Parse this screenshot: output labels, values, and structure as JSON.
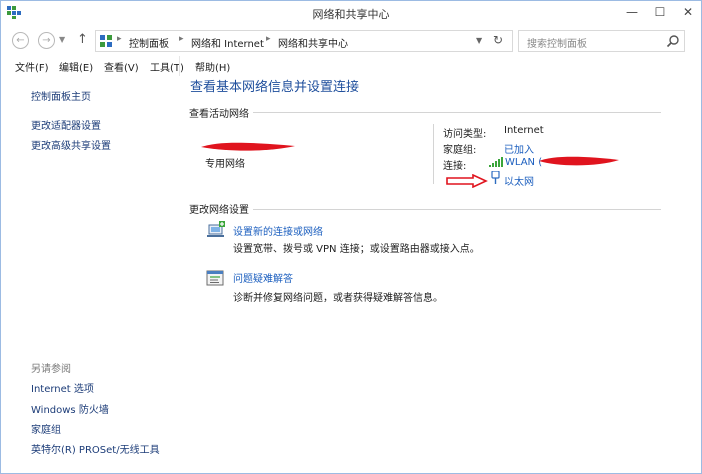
{
  "window": {
    "title": "网络和共享中心",
    "controls": {
      "minimize": "—",
      "maximize": "☐",
      "close": "✕"
    }
  },
  "address_bar": {
    "breadcrumbs": [
      "控制面板",
      "网络和 Internet",
      "网络和共享中心"
    ],
    "search_placeholder": "搜索控制面板"
  },
  "menu": [
    "文件(F)",
    "编辑(E)",
    "查看(V)",
    "工具(T)",
    "帮助(H)"
  ],
  "sidebar": {
    "links": [
      "控制面板主页",
      "更改适配器设置",
      "更改高级共享设置"
    ],
    "see_also_title": "另请参阅",
    "see_also": [
      "Internet 选项",
      "Windows 防火墙",
      "家庭组",
      "英特尔(R) PROSet/无线工具"
    ]
  },
  "main": {
    "title": "查看基本网络信息并设置连接",
    "active_section": "查看活动网络",
    "network": {
      "type": "专用网络",
      "access_label": "访问类型:",
      "access_value": "Internet",
      "homegroup_label": "家庭组:",
      "homegroup_value": "已加入",
      "connections_label": "连接:",
      "wlan": "WLAN (",
      "ethernet": "以太网"
    },
    "change_section": "更改网络设置",
    "tasks": [
      {
        "link": "设置新的连接或网络",
        "desc": "设置宽带、拨号或 VPN 连接；或设置路由器或接入点。"
      },
      {
        "link": "问题疑难解答",
        "desc": "诊断并修复网络问题，或者获得疑难解答信息。"
      }
    ]
  },
  "colors": {
    "link": "#1c5fbf",
    "title_blue": "#1e4e9c",
    "redaction": "#e0141e",
    "wifi_green": "#3aa53a"
  }
}
